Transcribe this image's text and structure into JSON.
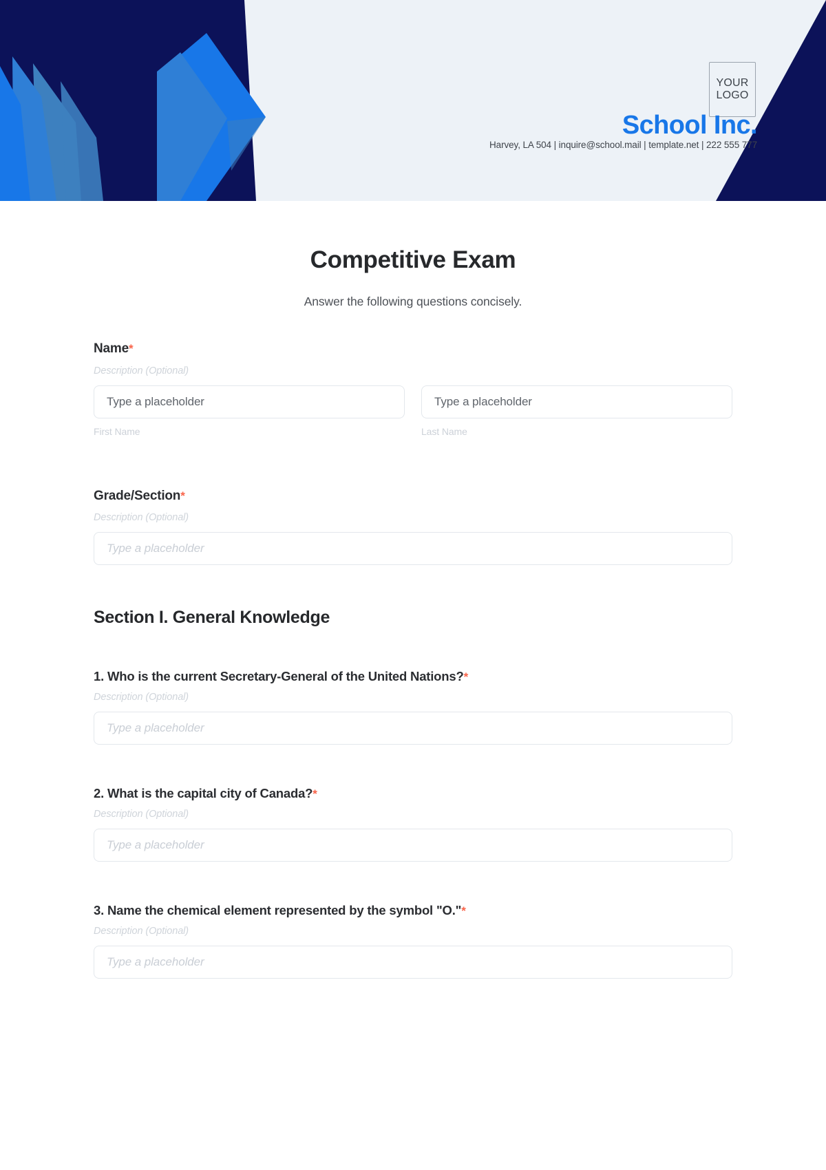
{
  "header": {
    "logo_line1": "YOUR",
    "logo_line2": "LOGO",
    "company_name": "School Inc.",
    "contact": "Harvey, LA 504 | inquire@school.mail | template.net | 222 555 777",
    "colors": {
      "banner_bg": "#edf2f7",
      "navy": "#0c1259",
      "blue_bright": "#1877e8",
      "blue_mid": "#2f7fd6",
      "blue_steel": "#3d80bf"
    }
  },
  "form": {
    "title": "Competitive Exam",
    "subtitle": "Answer the following questions concisely.",
    "required_marker": "*",
    "description_placeholder": "Description (Optional)",
    "input_placeholder": "Type a placeholder",
    "required_color": "#f9644a"
  },
  "fields": {
    "name": {
      "label": "Name",
      "description": "Description (Optional)",
      "first": {
        "placeholder": "Type a placeholder",
        "caption": "First Name"
      },
      "last": {
        "placeholder": "Type a placeholder",
        "caption": "Last Name"
      }
    },
    "grade_section": {
      "label": "Grade/Section",
      "description": "Description (Optional)",
      "placeholder": "Type a placeholder"
    }
  },
  "section_one": {
    "heading": "Section I. General Knowledge",
    "questions": [
      {
        "label": "1. Who is the current Secretary-General of the United Nations?",
        "description": "Description (Optional)",
        "placeholder": "Type a placeholder"
      },
      {
        "label": "2. What is the capital city of Canada?",
        "description": "Description (Optional)",
        "placeholder": "Type a placeholder"
      },
      {
        "label": "3. Name the chemical element represented by the symbol \"O.\"",
        "description": "Description (Optional)",
        "placeholder": "Type a placeholder"
      }
    ]
  }
}
